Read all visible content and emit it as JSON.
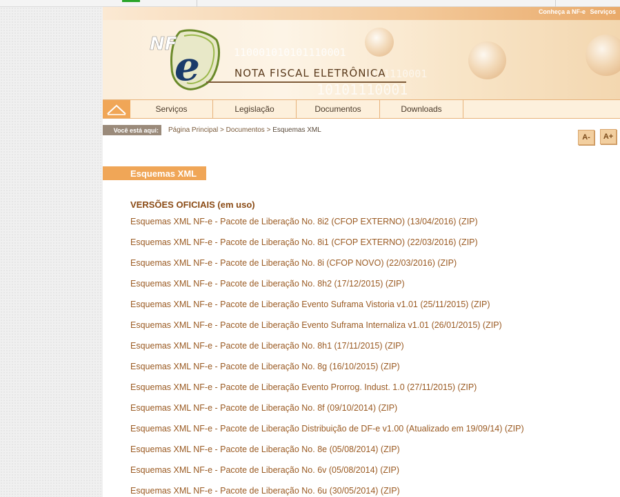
{
  "header": {
    "links": [
      "Conheça a NF-e",
      "Serviços"
    ],
    "logo_text": "NF-e",
    "title": "NOTA FISCAL ELETRÔNICA",
    "binary": [
      "110001010101110001",
      "10101110001",
      "0101110001"
    ]
  },
  "nav": {
    "items": [
      "Serviços",
      "Legislação",
      "Documentos",
      "Downloads"
    ]
  },
  "breadcrumb": {
    "label": "Você está aqui:",
    "items": [
      "Página Principal",
      "Documentos",
      "Esquemas XML"
    ],
    "separator": ">"
  },
  "font_controls": {
    "decrease": "A-",
    "increase": "A+"
  },
  "section": {
    "title": "Esquemas XML",
    "heading": "VERSÕES OFICIAIS (em uso)",
    "links": [
      "Esquemas XML NF-e - Pacote de Liberação No. 8i2 (CFOP EXTERNO) (13/04/2016) (ZIP)",
      "Esquemas XML NF-e - Pacote de Liberação No. 8i1 (CFOP EXTERNO) (22/03/2016) (ZIP)",
      "Esquemas XML NF-e - Pacote de Liberação No. 8i (CFOP NOVO) (22/03/2016) (ZIP)",
      "Esquemas XML NF-e - Pacote de Liberação No. 8h2 (17/12/2015) (ZIP)",
      "Esquemas XML NF-e - Pacote de Liberação Evento Suframa Vistoria v1.01 (25/11/2015) (ZIP)",
      "Esquemas XML NF-e - Pacote de Liberação Evento Suframa Internaliza v1.01 (26/01/2015) (ZIP)",
      "Esquemas XML NF-e - Pacote de Liberação No. 8h1 (17/11/2015) (ZIP)",
      "Esquemas XML NF-e - Pacote de Liberação No. 8g (16/10/2015) (ZIP)",
      "Esquemas XML NF-e - Pacote de Liberação Evento Prorrog. Indust. 1.0 (27/11/2015) (ZIP)",
      "Esquemas XML NF-e - Pacote de Liberação No. 8f (09/10/2014) (ZIP)",
      "Esquemas XML NF-e - Pacote de Liberação Distribuição de DF-e v1.00 (Atualizado em 19/09/14) (ZIP)",
      "Esquemas XML NF-e - Pacote de Liberação No. 8e (05/08/2014) (ZIP)",
      "Esquemas XML NF-e - Pacote de Liberação No. 6v (05/08/2014) (ZIP)",
      "Esquemas XML NF-e - Pacote de Liberação No. 6u (30/05/2014) (ZIP)"
    ]
  },
  "colors": {
    "accent": "#f0a657",
    "link": "#9a5a22",
    "heading": "#8a4a14"
  }
}
